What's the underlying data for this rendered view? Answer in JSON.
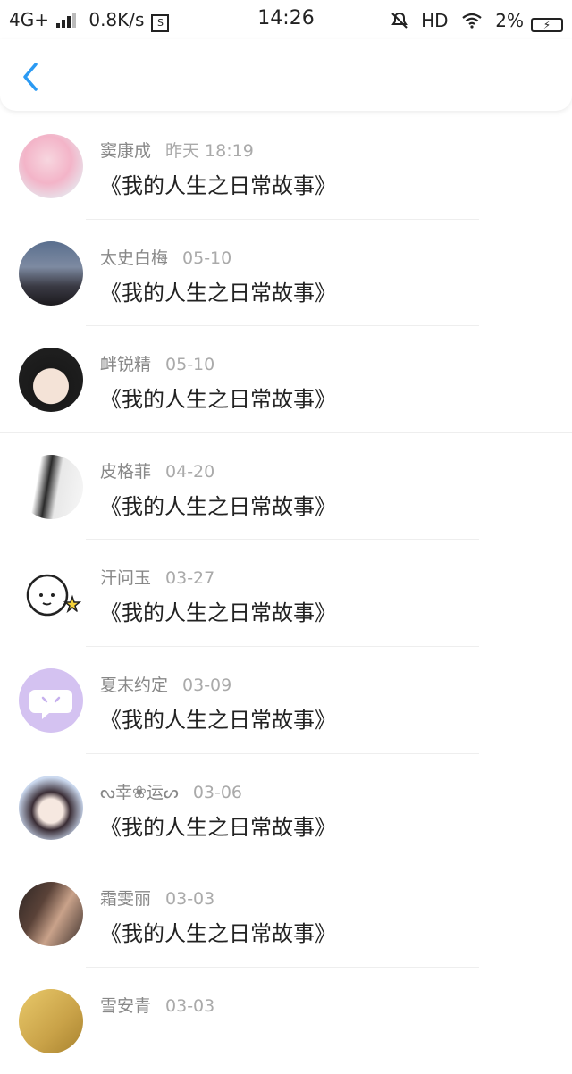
{
  "status_bar": {
    "network": "4G+",
    "speed": "0.8K/s",
    "time": "14:26",
    "hd": "HD",
    "battery": "2%"
  },
  "colors": {
    "accent": "#2b9af3",
    "name_text": "#888888",
    "time_text": "#aaaaaa",
    "title_text": "#222222"
  },
  "items": [
    {
      "name": "窦康成",
      "time": "昨天 18:19",
      "title": "《我的人生之日常故事》"
    },
    {
      "name": "太史白梅",
      "time": "05-10",
      "title": "《我的人生之日常故事》"
    },
    {
      "name": "衅锐精",
      "time": "05-10",
      "title": "《我的人生之日常故事》"
    },
    {
      "name": "皮格菲",
      "time": "04-20",
      "title": "《我的人生之日常故事》"
    },
    {
      "name": "汗问玉",
      "time": "03-27",
      "title": "《我的人生之日常故事》"
    },
    {
      "name": "夏末约定",
      "time": "03-09",
      "title": "《我的人生之日常故事》"
    },
    {
      "name": "ᔓ幸❀运ᔕ",
      "time": "03-06",
      "title": "《我的人生之日常故事》"
    },
    {
      "name": "霜雯丽",
      "time": "03-03",
      "title": "《我的人生之日常故事》"
    },
    {
      "name": "雪安青",
      "time": "03-03",
      "title": ""
    }
  ]
}
